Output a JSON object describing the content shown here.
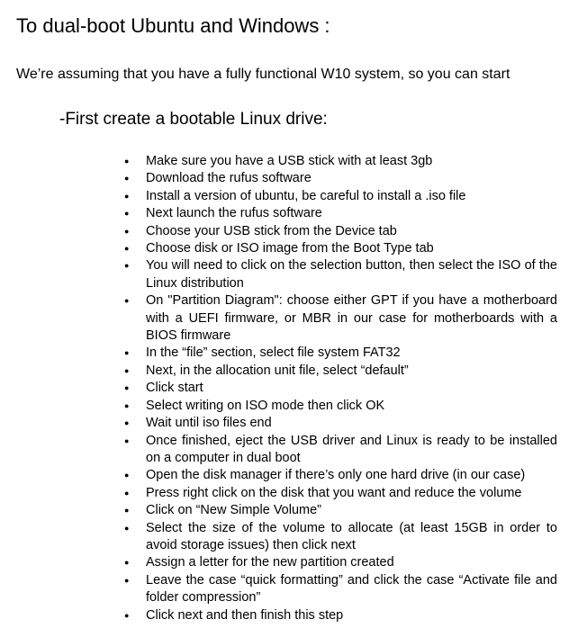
{
  "document": {
    "title": "To dual-boot Ubuntu and Windows :",
    "intro": "We’re assuming that you have a fully functional W10 system, so you can start",
    "section_heading": "-First create a bootable Linux drive:",
    "steps": [
      "Make sure you have a USB stick with at least 3gb",
      "Download the rufus software",
      "Install a version of ubuntu, be careful to install a .iso file",
      "Next launch the rufus software",
      "Choose your USB stick from the Device tab",
      "Choose disk or ISO image from the Boot Type tab",
      "You will need to click on the selection button, then select the ISO of the Linux distribution",
      "On \"Partition Diagram\": choose either GPT if you have a motherboard with a UEFI firmware, or MBR in our case for motherboards with a BIOS firmware",
      "In the “file” section, select file system FAT32",
      "Next, in the allocation unit file, select “default”",
      "Click start",
      "Select writing on ISO mode then click OK",
      "Wait until iso files end",
      "Once finished, eject the USB driver and Linux is ready to be installed on a computer in dual boot",
      "Open the disk manager if there’s only one hard drive (in our case)",
      "Press right click on the disk that you want and reduce the volume",
      "Click on “New Simple Volume”",
      "Select the size of the volume to allocate (at least 15GB in order to avoid storage issues) then click next",
      "Assign a letter for the new partition created",
      "Leave the case “quick formatting” and click the case “Activate file and folder compression”",
      "Click next and then finish this step"
    ]
  }
}
